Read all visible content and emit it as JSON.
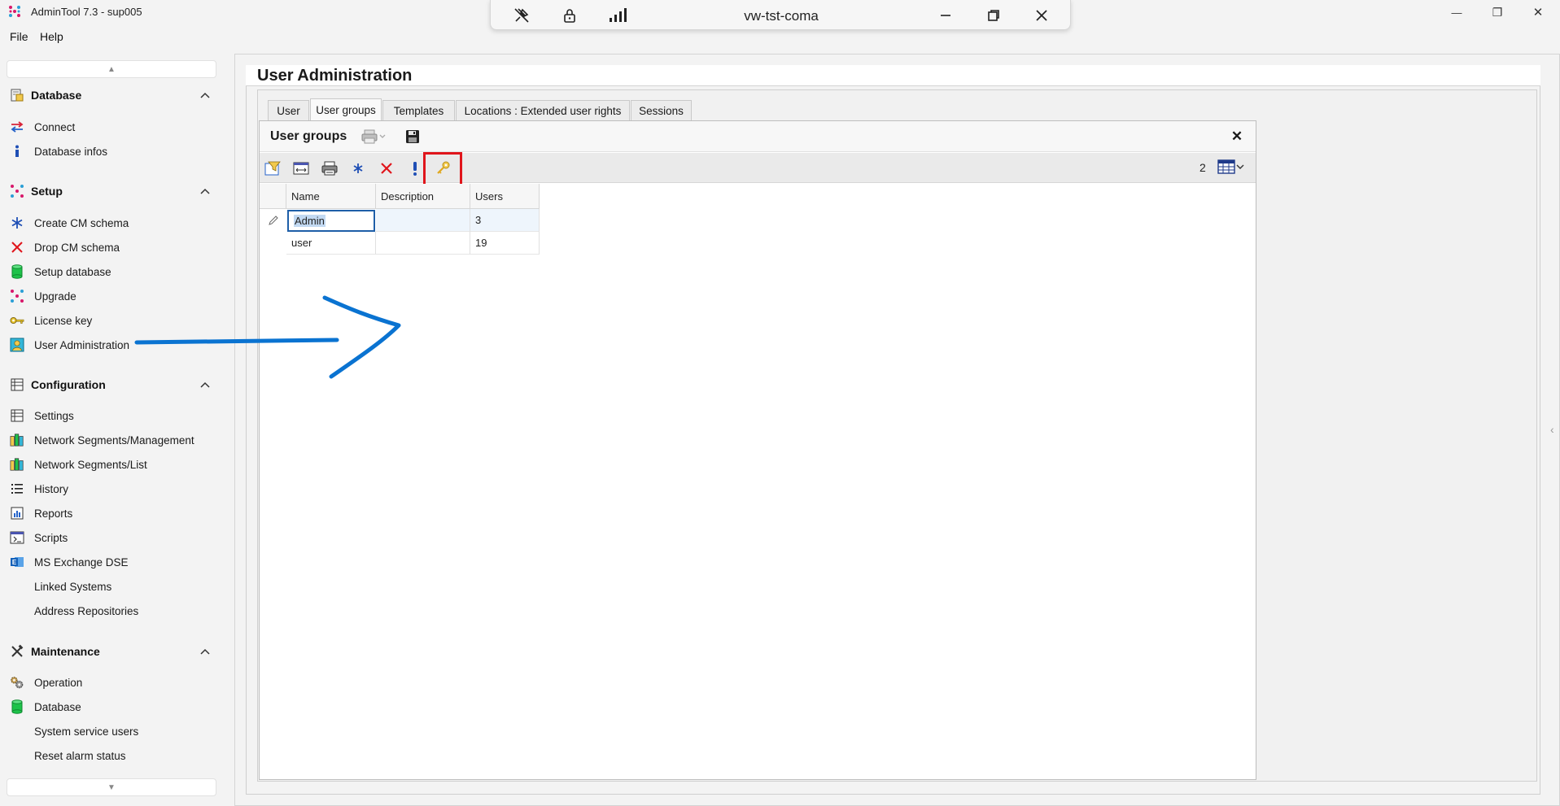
{
  "window": {
    "title": "AdminTool 7.3 - sup005",
    "minimize": "—",
    "maximize": "❐",
    "close": "✕"
  },
  "remote_bar": {
    "host": "vw-tst-coma"
  },
  "menu": {
    "file": "File",
    "help": "Help"
  },
  "sidebar": {
    "scroll_up": "▲",
    "scroll_down": "▼",
    "sections": {
      "database": {
        "label": "Database",
        "items": [
          "Connect",
          "Database infos"
        ]
      },
      "setup": {
        "label": "Setup",
        "items": [
          "Create CM schema",
          "Drop CM schema",
          "Setup database",
          "Upgrade",
          "License key",
          "User Administration"
        ]
      },
      "configuration": {
        "label": "Configuration",
        "items": [
          "Settings",
          "Network Segments/Management",
          "Network Segments/List",
          "History",
          "Reports",
          "Scripts",
          "MS Exchange DSE",
          "Linked Systems",
          "Address Repositories"
        ]
      },
      "maintenance": {
        "label": "Maintenance",
        "items": [
          "Operation",
          "Database",
          "System service users",
          "Reset alarm status"
        ]
      }
    }
  },
  "main": {
    "title": "User Administration",
    "tabs": [
      "User",
      "User groups",
      "Templates",
      "Locations : Extended user rights",
      "Sessions"
    ],
    "active_tab": "User groups",
    "panel": {
      "title": "User groups",
      "close": "✕",
      "row_count": "2"
    },
    "table": {
      "columns": [
        "Name",
        "Description",
        "Users"
      ],
      "rows": [
        {
          "name": "Admin",
          "description": "",
          "users": "3"
        },
        {
          "name": "user",
          "description": "",
          "users": "19"
        }
      ]
    }
  },
  "colors": {
    "highlight_box": "#e0151b",
    "annotation_arrow": "#0a73d1",
    "selection": "#c2d9f2"
  }
}
